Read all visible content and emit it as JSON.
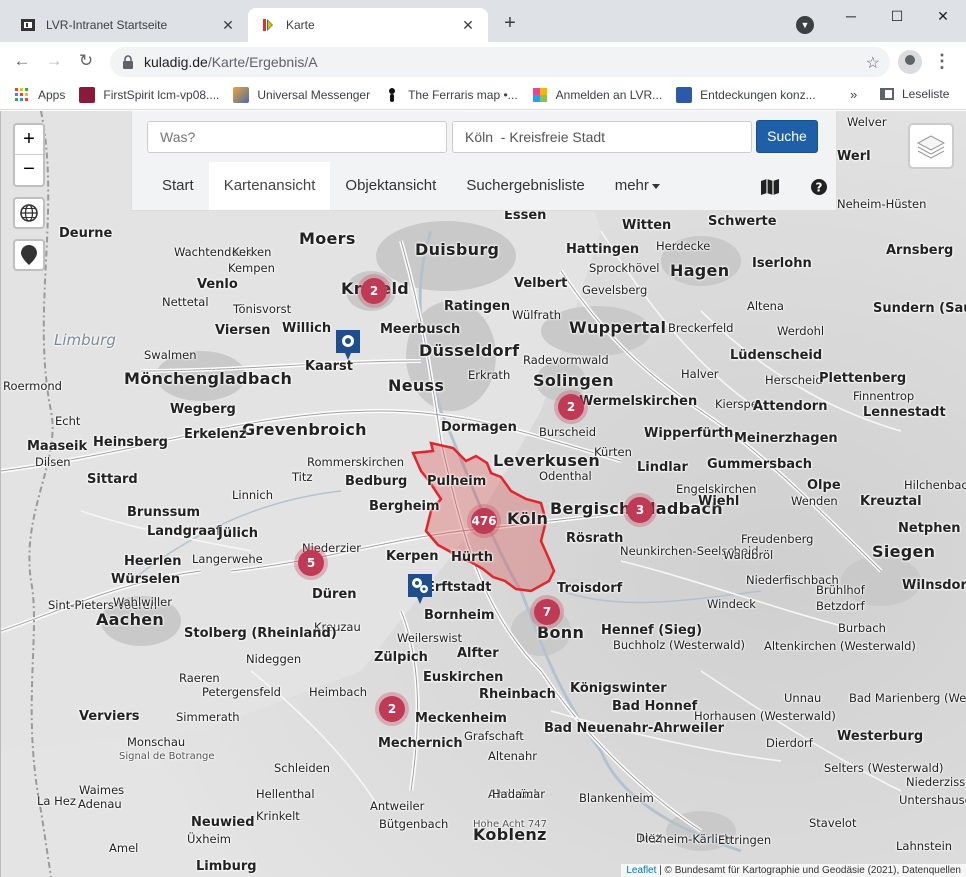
{
  "browser": {
    "tabs": [
      {
        "title": "LVR-Intranet Startseite",
        "active": false
      },
      {
        "title": "Karte",
        "active": true
      }
    ],
    "new_tab": "+",
    "window": {
      "minimize": "─",
      "maximize": "☐",
      "close": "✕"
    },
    "url_host": "kuladig.de",
    "url_path": "/Karte/Ergebnis/A",
    "bookmarks": [
      {
        "label": "Apps",
        "color": "#ea4335"
      },
      {
        "label": "FirstSpirit lcm-vp08....",
        "color": "#8b1a3a"
      },
      {
        "label": "Universal Messenger",
        "color": "#4a6fa5"
      },
      {
        "label": "The Ferraris map •...",
        "color": "#111111"
      },
      {
        "label": "Anmelden an LVR...",
        "color": "#e24a8d"
      },
      {
        "label": "Entdeckungen konz...",
        "color": "#2a5aa8"
      }
    ],
    "bookmarks_more": "»",
    "reading_list": "Leseliste"
  },
  "search": {
    "what_placeholder": "Was?",
    "where_value": "Köln  - Kreisfreie Stadt",
    "button": "Suche"
  },
  "nav": {
    "tabs": [
      "Start",
      "Kartenansicht",
      "Objektansicht",
      "Suchergebnisliste",
      "mehr"
    ],
    "active_index": 1
  },
  "map": {
    "zoom_in": "+",
    "zoom_out": "−",
    "clusters": [
      {
        "count": "2",
        "near": "Krefeld"
      },
      {
        "count": "2",
        "near": "Burscheid"
      },
      {
        "count": "476",
        "near": "Köln"
      },
      {
        "count": "3",
        "near": "Bergisch Gladbach"
      },
      {
        "count": "5",
        "near": "Niederzier"
      },
      {
        "count": "7",
        "near": "Bonn"
      },
      {
        "count": "2",
        "near": "Mechernich"
      }
    ],
    "attribution_leaflet": "Leaflet",
    "attribution_text": " | © Bundesamt für Kartographie und Geodäsie (2021), Datenquellen",
    "highlight_color": "#e0262c",
    "places": [
      {
        "t": "Essen",
        "c": "mid"
      },
      {
        "t": "Witten",
        "c": "mid"
      },
      {
        "t": "Schwerte",
        "c": "mid"
      },
      {
        "t": "Welver",
        "c": "sm"
      },
      {
        "t": "Werl",
        "c": "mid"
      },
      {
        "t": "Neheim-Hüsten",
        "c": "sm"
      },
      {
        "t": "Arnsberg",
        "c": "mid"
      },
      {
        "t": "Moers",
        "c": "big"
      },
      {
        "t": "Duisburg",
        "c": "big"
      },
      {
        "t": "Hattingen",
        "c": "mid"
      },
      {
        "t": "Herdecke",
        "c": "sm"
      },
      {
        "t": "Sprockhövel",
        "c": "sm"
      },
      {
        "t": "Hagen",
        "c": "big"
      },
      {
        "t": "Iserlohn",
        "c": "mid"
      },
      {
        "t": "Deurne",
        "c": "mid"
      },
      {
        "t": "Wachtendonk",
        "c": "sm"
      },
      {
        "t": "Kerken",
        "c": "sm"
      },
      {
        "t": "Kempen",
        "c": "sm"
      },
      {
        "t": "Venlo",
        "c": "mid"
      },
      {
        "t": "Krefeld",
        "c": "big"
      },
      {
        "t": "Velbert",
        "c": "mid"
      },
      {
        "t": "Gevelsberg",
        "c": "sm"
      },
      {
        "t": "Altena",
        "c": "sm"
      },
      {
        "t": "Sundern (Sauerland)",
        "c": "mid"
      },
      {
        "t": "Nettetal",
        "c": "sm"
      },
      {
        "t": "Tönisvorst",
        "c": "sm"
      },
      {
        "t": "Ratingen",
        "c": "mid"
      },
      {
        "t": "Wülfrath",
        "c": "sm"
      },
      {
        "t": "Wuppertal",
        "c": "big"
      },
      {
        "t": "Breckerfeld",
        "c": "sm"
      },
      {
        "t": "Werdohl",
        "c": "sm"
      },
      {
        "t": "Viersen",
        "c": "mid"
      },
      {
        "t": "Willich",
        "c": "mid"
      },
      {
        "t": "Meerbusch",
        "c": "mid"
      },
      {
        "t": "Limburg",
        "c": "water"
      },
      {
        "t": "Düsseldorf",
        "c": "big"
      },
      {
        "t": "Lüdenscheid",
        "c": "mid"
      },
      {
        "t": "Swalmen",
        "c": "sm"
      },
      {
        "t": "Kaarst",
        "c": "mid"
      },
      {
        "t": "Radevormwald",
        "c": "sm"
      },
      {
        "t": "Mönchengladbach",
        "c": "big"
      },
      {
        "t": "Neuss",
        "c": "big"
      },
      {
        "t": "Erkrath",
        "c": "sm"
      },
      {
        "t": "Solingen",
        "c": "big"
      },
      {
        "t": "Halver",
        "c": "sm"
      },
      {
        "t": "Herscheid",
        "c": "sm"
      },
      {
        "t": "Plettenberg",
        "c": "mid"
      },
      {
        "t": "Roermond",
        "c": "sm"
      },
      {
        "t": "Wermelskirchen",
        "c": "mid"
      },
      {
        "t": "Kierspe",
        "c": "sm"
      },
      {
        "t": "Attendorn",
        "c": "mid"
      },
      {
        "t": "Finnentrop",
        "c": "sm"
      },
      {
        "t": "Lennestadt",
        "c": "mid"
      },
      {
        "t": "Wegberg",
        "c": "mid"
      },
      {
        "t": "Grevenbroich",
        "c": "big"
      },
      {
        "t": "Dormagen",
        "c": "mid"
      },
      {
        "t": "Burscheid",
        "c": "sm"
      },
      {
        "t": "Wipperfürth",
        "c": "mid"
      },
      {
        "t": "Meinerzhagen",
        "c": "mid"
      },
      {
        "t": "Echt",
        "c": "sm"
      },
      {
        "t": "Heinsberg",
        "c": "mid"
      },
      {
        "t": "Erkelenz",
        "c": "mid"
      },
      {
        "t": "Leverkusen",
        "c": "big"
      },
      {
        "t": "Maaseik",
        "c": "mid"
      },
      {
        "t": "Dilsen",
        "c": "sm"
      },
      {
        "t": "Rommerskirchen",
        "c": "sm"
      },
      {
        "t": "Kürten",
        "c": "sm"
      },
      {
        "t": "Lindlar",
        "c": "mid"
      },
      {
        "t": "Gummersbach",
        "c": "mid"
      },
      {
        "t": "Sittard",
        "c": "mid"
      },
      {
        "t": "Titz",
        "c": "sm"
      },
      {
        "t": "Bedburg",
        "c": "mid"
      },
      {
        "t": "Pulheim",
        "c": "mid"
      },
      {
        "t": "Odenthal",
        "c": "sm"
      },
      {
        "t": "Engelskirchen",
        "c": "sm"
      },
      {
        "t": "Olpe",
        "c": "mid"
      },
      {
        "t": "Hilchenbach",
        "c": "sm"
      },
      {
        "t": "Linnich",
        "c": "sm"
      },
      {
        "t": "Brunssum",
        "c": "mid"
      },
      {
        "t": "Bergheim",
        "c": "mid"
      },
      {
        "t": "Köln",
        "c": "big"
      },
      {
        "t": "Bergisch Gladbach",
        "c": "big"
      },
      {
        "t": "Wiehl",
        "c": "mid"
      },
      {
        "t": "Wenden",
        "c": "sm"
      },
      {
        "t": "Kreuztal",
        "c": "mid"
      },
      {
        "t": "Landgraaf",
        "c": "mid"
      },
      {
        "t": "Jülich",
        "c": "mid"
      },
      {
        "t": "Rösrath",
        "c": "mid"
      },
      {
        "t": "Netphen",
        "c": "mid"
      },
      {
        "t": "Niederzier",
        "c": "sm"
      },
      {
        "t": "Kerpen",
        "c": "mid"
      },
      {
        "t": "Hürth",
        "c": "mid"
      },
      {
        "t": "Neunkirchen-Seelscheid",
        "c": "sm"
      },
      {
        "t": "Waldbröl",
        "c": "sm"
      },
      {
        "t": "Siegen",
        "c": "big"
      },
      {
        "t": "Heerlen",
        "c": "mid"
      },
      {
        "t": "Langerwehe",
        "c": "sm"
      },
      {
        "t": "Freudenberg",
        "c": "sm"
      },
      {
        "t": "Würselen",
        "c": "mid"
      },
      {
        "t": "Düren",
        "c": "mid"
      },
      {
        "t": "Erftstadt",
        "c": "mid"
      },
      {
        "t": "Troisdorf",
        "c": "mid"
      },
      {
        "t": "Niederfischbach",
        "c": "sm"
      },
      {
        "t": "Wilnsdorf",
        "c": "mid"
      },
      {
        "t": "Sint-Pieters-Voeren",
        "c": "sm"
      },
      {
        "t": "Wahlwiller",
        "c": "sm"
      },
      {
        "t": "Brühlhof",
        "c": "sm"
      },
      {
        "t": "Betzdorf",
        "c": "sm"
      },
      {
        "t": "Aachen",
        "c": "big"
      },
      {
        "t": "Bornheim",
        "c": "mid"
      },
      {
        "t": "Windeck",
        "c": "sm"
      },
      {
        "t": "Kreuzau",
        "c": "sm"
      },
      {
        "t": "Bonn",
        "c": "big"
      },
      {
        "t": "Hennef (Sieg)",
        "c": "mid"
      },
      {
        "t": "Stolberg (Rheinland)",
        "c": "mid"
      },
      {
        "t": "Weilerswist",
        "c": "sm"
      },
      {
        "t": "Buchholz (Westerwald)",
        "c": "sm"
      },
      {
        "t": "Burbach",
        "c": "sm"
      },
      {
        "t": "Nideggen",
        "c": "sm"
      },
      {
        "t": "Zülpich",
        "c": "mid"
      },
      {
        "t": "Alfter",
        "c": "mid"
      },
      {
        "t": "Altenkirchen (Westerwald)",
        "c": "sm"
      },
      {
        "t": "Raeren",
        "c": "sm"
      },
      {
        "t": "Euskirchen",
        "c": "mid"
      },
      {
        "t": "Petergensfeld",
        "c": "sm"
      },
      {
        "t": "Heimbach",
        "c": "sm"
      },
      {
        "t": "Rheinbach",
        "c": "mid"
      },
      {
        "t": "Königswinter",
        "c": "mid"
      },
      {
        "t": "Bad Honnef",
        "c": "mid"
      },
      {
        "t": "Unnau",
        "c": "sm"
      },
      {
        "t": "Bad Marienberg (Westerwald)",
        "c": "sm"
      },
      {
        "t": "Verviers",
        "c": "mid"
      },
      {
        "t": "Simmerath",
        "c": "sm"
      },
      {
        "t": "Meckenheim",
        "c": "mid"
      },
      {
        "t": "Horhausen (Westerwald)",
        "c": "sm"
      },
      {
        "t": "Monschau",
        "c": "sm"
      },
      {
        "t": "Mechernich",
        "c": "mid"
      },
      {
        "t": "Grafschaft",
        "c": "sm"
      },
      {
        "t": "Bad Neuenahr-Ahrweiler",
        "c": "mid"
      },
      {
        "t": "Westerburg",
        "c": "mid"
      },
      {
        "t": "Dierdorf",
        "c": "sm"
      },
      {
        "t": "Signal de Botrange",
        "c": "xs"
      },
      {
        "t": "Schleiden",
        "c": "sm"
      },
      {
        "t": "Altenahr",
        "c": "sm"
      },
      {
        "t": "Selters (Westerwald)",
        "c": "sm"
      },
      {
        "t": "Waimes",
        "c": "sm"
      },
      {
        "t": "Hellenthal",
        "c": "sm"
      },
      {
        "t": "Ahrbrück",
        "c": "sm"
      },
      {
        "t": "Niederzissen",
        "c": "sm"
      },
      {
        "t": "La Hez",
        "c": "sm"
      },
      {
        "t": "Krinkelt",
        "c": "sm"
      },
      {
        "t": "Hadamar",
        "c": "sm"
      },
      {
        "t": "Blankenheim",
        "c": "sm"
      },
      {
        "t": "Adenau",
        "c": "sm"
      },
      {
        "t": "Neuwied",
        "c": "mid"
      },
      {
        "t": "Untershausen",
        "c": "sm"
      },
      {
        "t": "Antweiler",
        "c": "sm"
      },
      {
        "t": "Hohe Acht 747",
        "c": "xs"
      },
      {
        "t": "Mülheim-Kärlich",
        "c": "sm"
      },
      {
        "t": "Stavelot",
        "c": "sm"
      },
      {
        "t": "Bütgenbach",
        "c": "sm"
      },
      {
        "t": "Koblenz",
        "c": "big"
      },
      {
        "t": "Diez",
        "c": "sm"
      },
      {
        "t": "Amel",
        "c": "sm"
      },
      {
        "t": "Üxheim",
        "c": "sm"
      },
      {
        "t": "Ettringen",
        "c": "sm"
      },
      {
        "t": "Lahnstein",
        "c": "sm"
      },
      {
        "t": "Limburg",
        "c": "mid"
      }
    ]
  }
}
